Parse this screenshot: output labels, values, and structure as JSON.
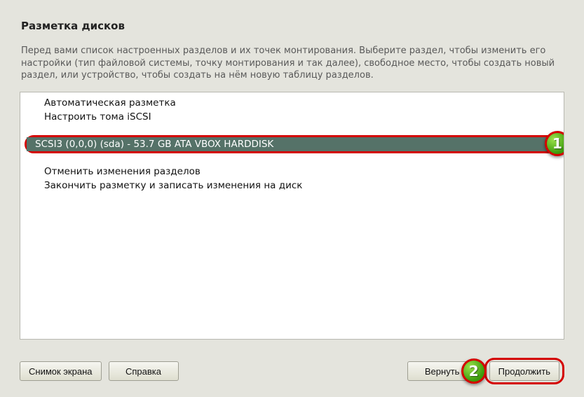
{
  "title": "Разметка дисков",
  "description": "Перед вами список настроенных разделов и их точек монтирования. Выберите раздел, чтобы изменить его настройки (тип файловой системы, точку монтирования и так далее), свободное место, чтобы создать новый раздел, или устройство, чтобы создать на нём новую таблицу разделов.",
  "items": {
    "auto": "Автоматическая разметка",
    "iscsi": "Настроить тома iSCSI",
    "disk": "SCSI3 (0,0,0) (sda) - 53.7 GB ATA VBOX HARDDISK",
    "undo": "Отменить изменения разделов",
    "finish": "Закончить разметку и записать изменения на диск"
  },
  "buttons": {
    "screenshot": "Снимок экрана",
    "help": "Справка",
    "back": "Вернуть",
    "continue": "Продолжить"
  },
  "callouts": {
    "one": "1",
    "two": "2"
  }
}
